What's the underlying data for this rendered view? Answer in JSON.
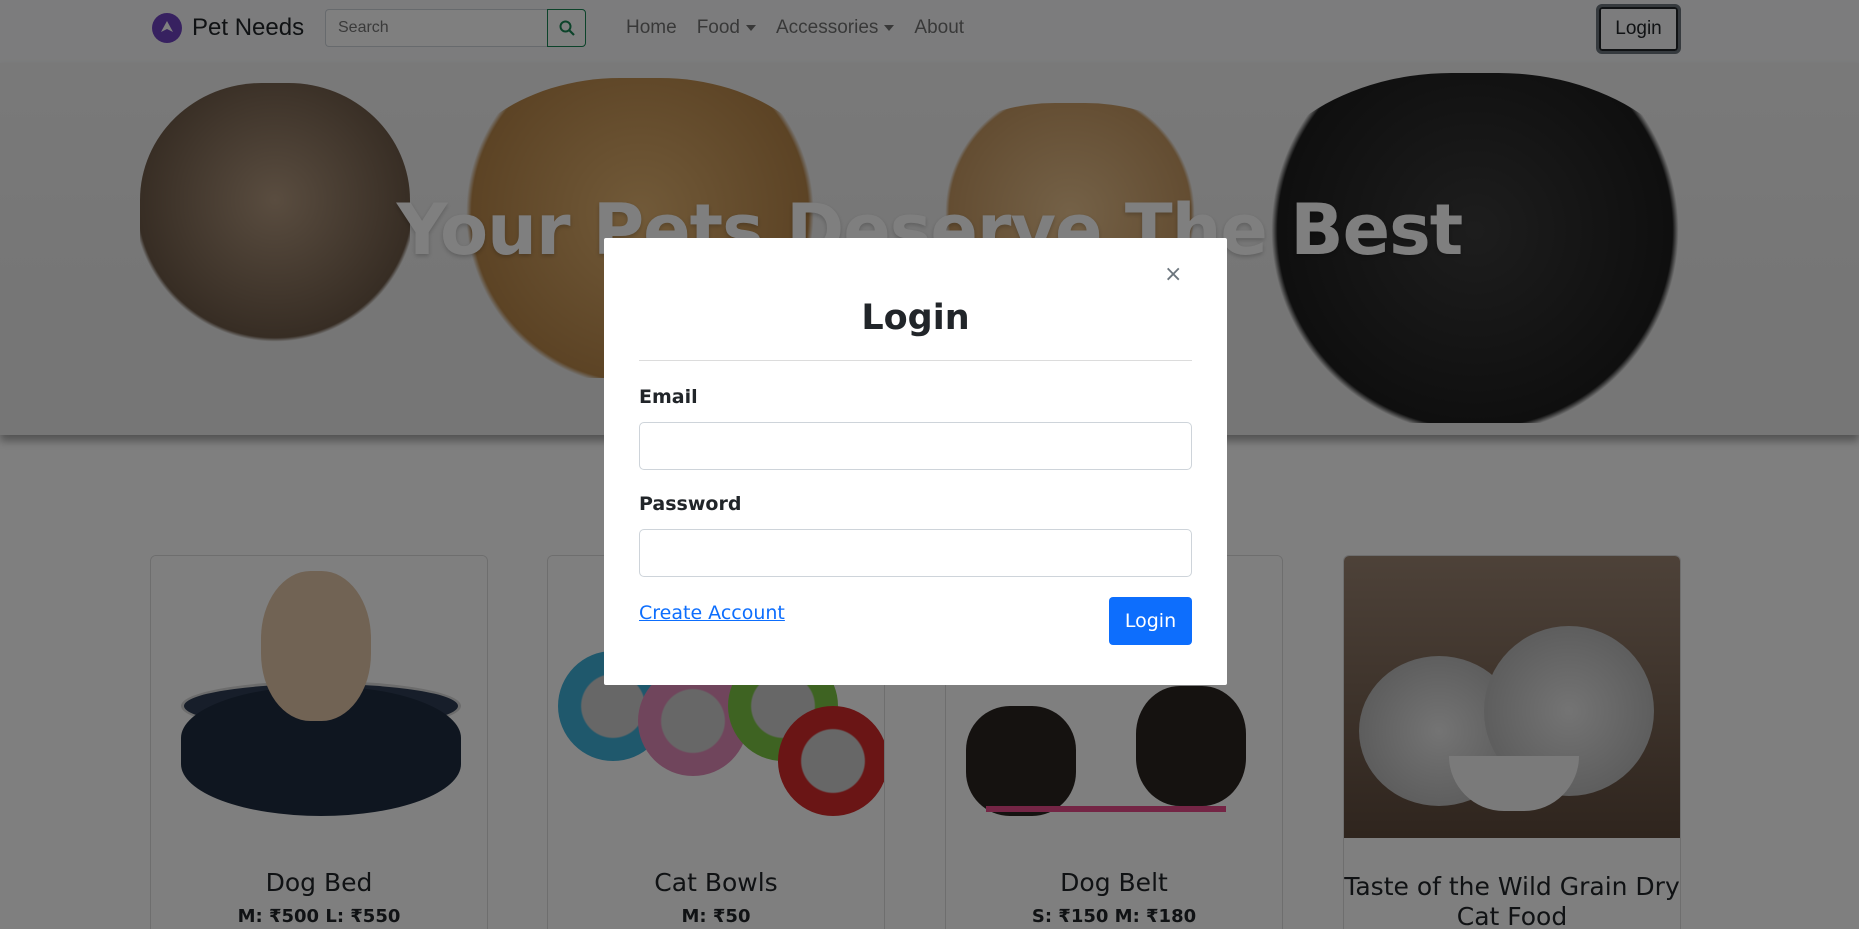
{
  "navbar": {
    "brand": "Pet Needs",
    "search_placeholder": "Search",
    "links": [
      "Home",
      "Food",
      "Accessories",
      "About"
    ],
    "login_label": "Login"
  },
  "hero": {
    "title": "Your Pets Deserve The Best"
  },
  "products": [
    {
      "name": "Dog Bed",
      "price": "M: ₹500 L: ₹550"
    },
    {
      "name": "Cat Bowls",
      "price": "M: ₹50"
    },
    {
      "name": "Dog Belt",
      "price": "S: ₹150 M: ₹180"
    },
    {
      "name": "Taste of the Wild Grain Dry Cat Food",
      "price": ""
    }
  ],
  "modal": {
    "close_symbol": "×",
    "title": "Login",
    "email_label": "Email",
    "email_value": "",
    "password_label": "Password",
    "password_value": "",
    "create_account_label": "Create Account",
    "submit_label": "Login"
  },
  "colors": {
    "primary": "#0d6efd",
    "search_border": "#198754",
    "brand_logo": "#6f42c1"
  }
}
